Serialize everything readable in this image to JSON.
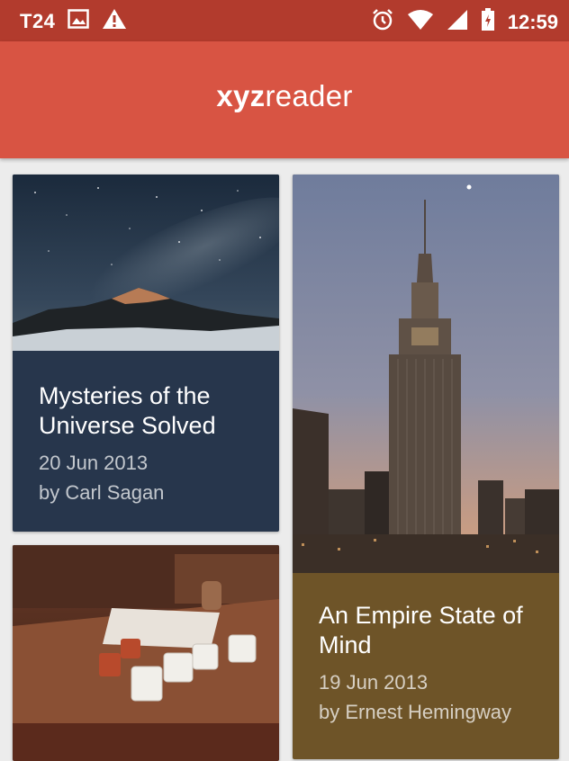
{
  "status_bar": {
    "carrier": "T24",
    "time": "12:59",
    "icons": [
      "image-icon",
      "warning-icon",
      "alarm-icon",
      "wifi-icon",
      "signal-icon",
      "battery-icon"
    ]
  },
  "app_bar": {
    "logo_bold": "xyz",
    "logo_light": "reader",
    "color": "#d85443",
    "status_color": "#b23b2d"
  },
  "articles": [
    {
      "title": "Mysteries of the Universe Solved",
      "date": "20 Jun 2013",
      "author": "by Carl Sagan",
      "image": "night-sky-mountain-photo",
      "color": "#27364c"
    },
    {
      "title": "An Empire State of Mind",
      "date": "19 Jun 2013",
      "author": "by Ernest Hemingway",
      "image": "empire-state-building-photo",
      "color": "#6e5428"
    },
    {
      "title": "",
      "date": "",
      "author": "",
      "image": "coffee-cups-table-photo",
      "color": "#5b2a1c"
    }
  ]
}
